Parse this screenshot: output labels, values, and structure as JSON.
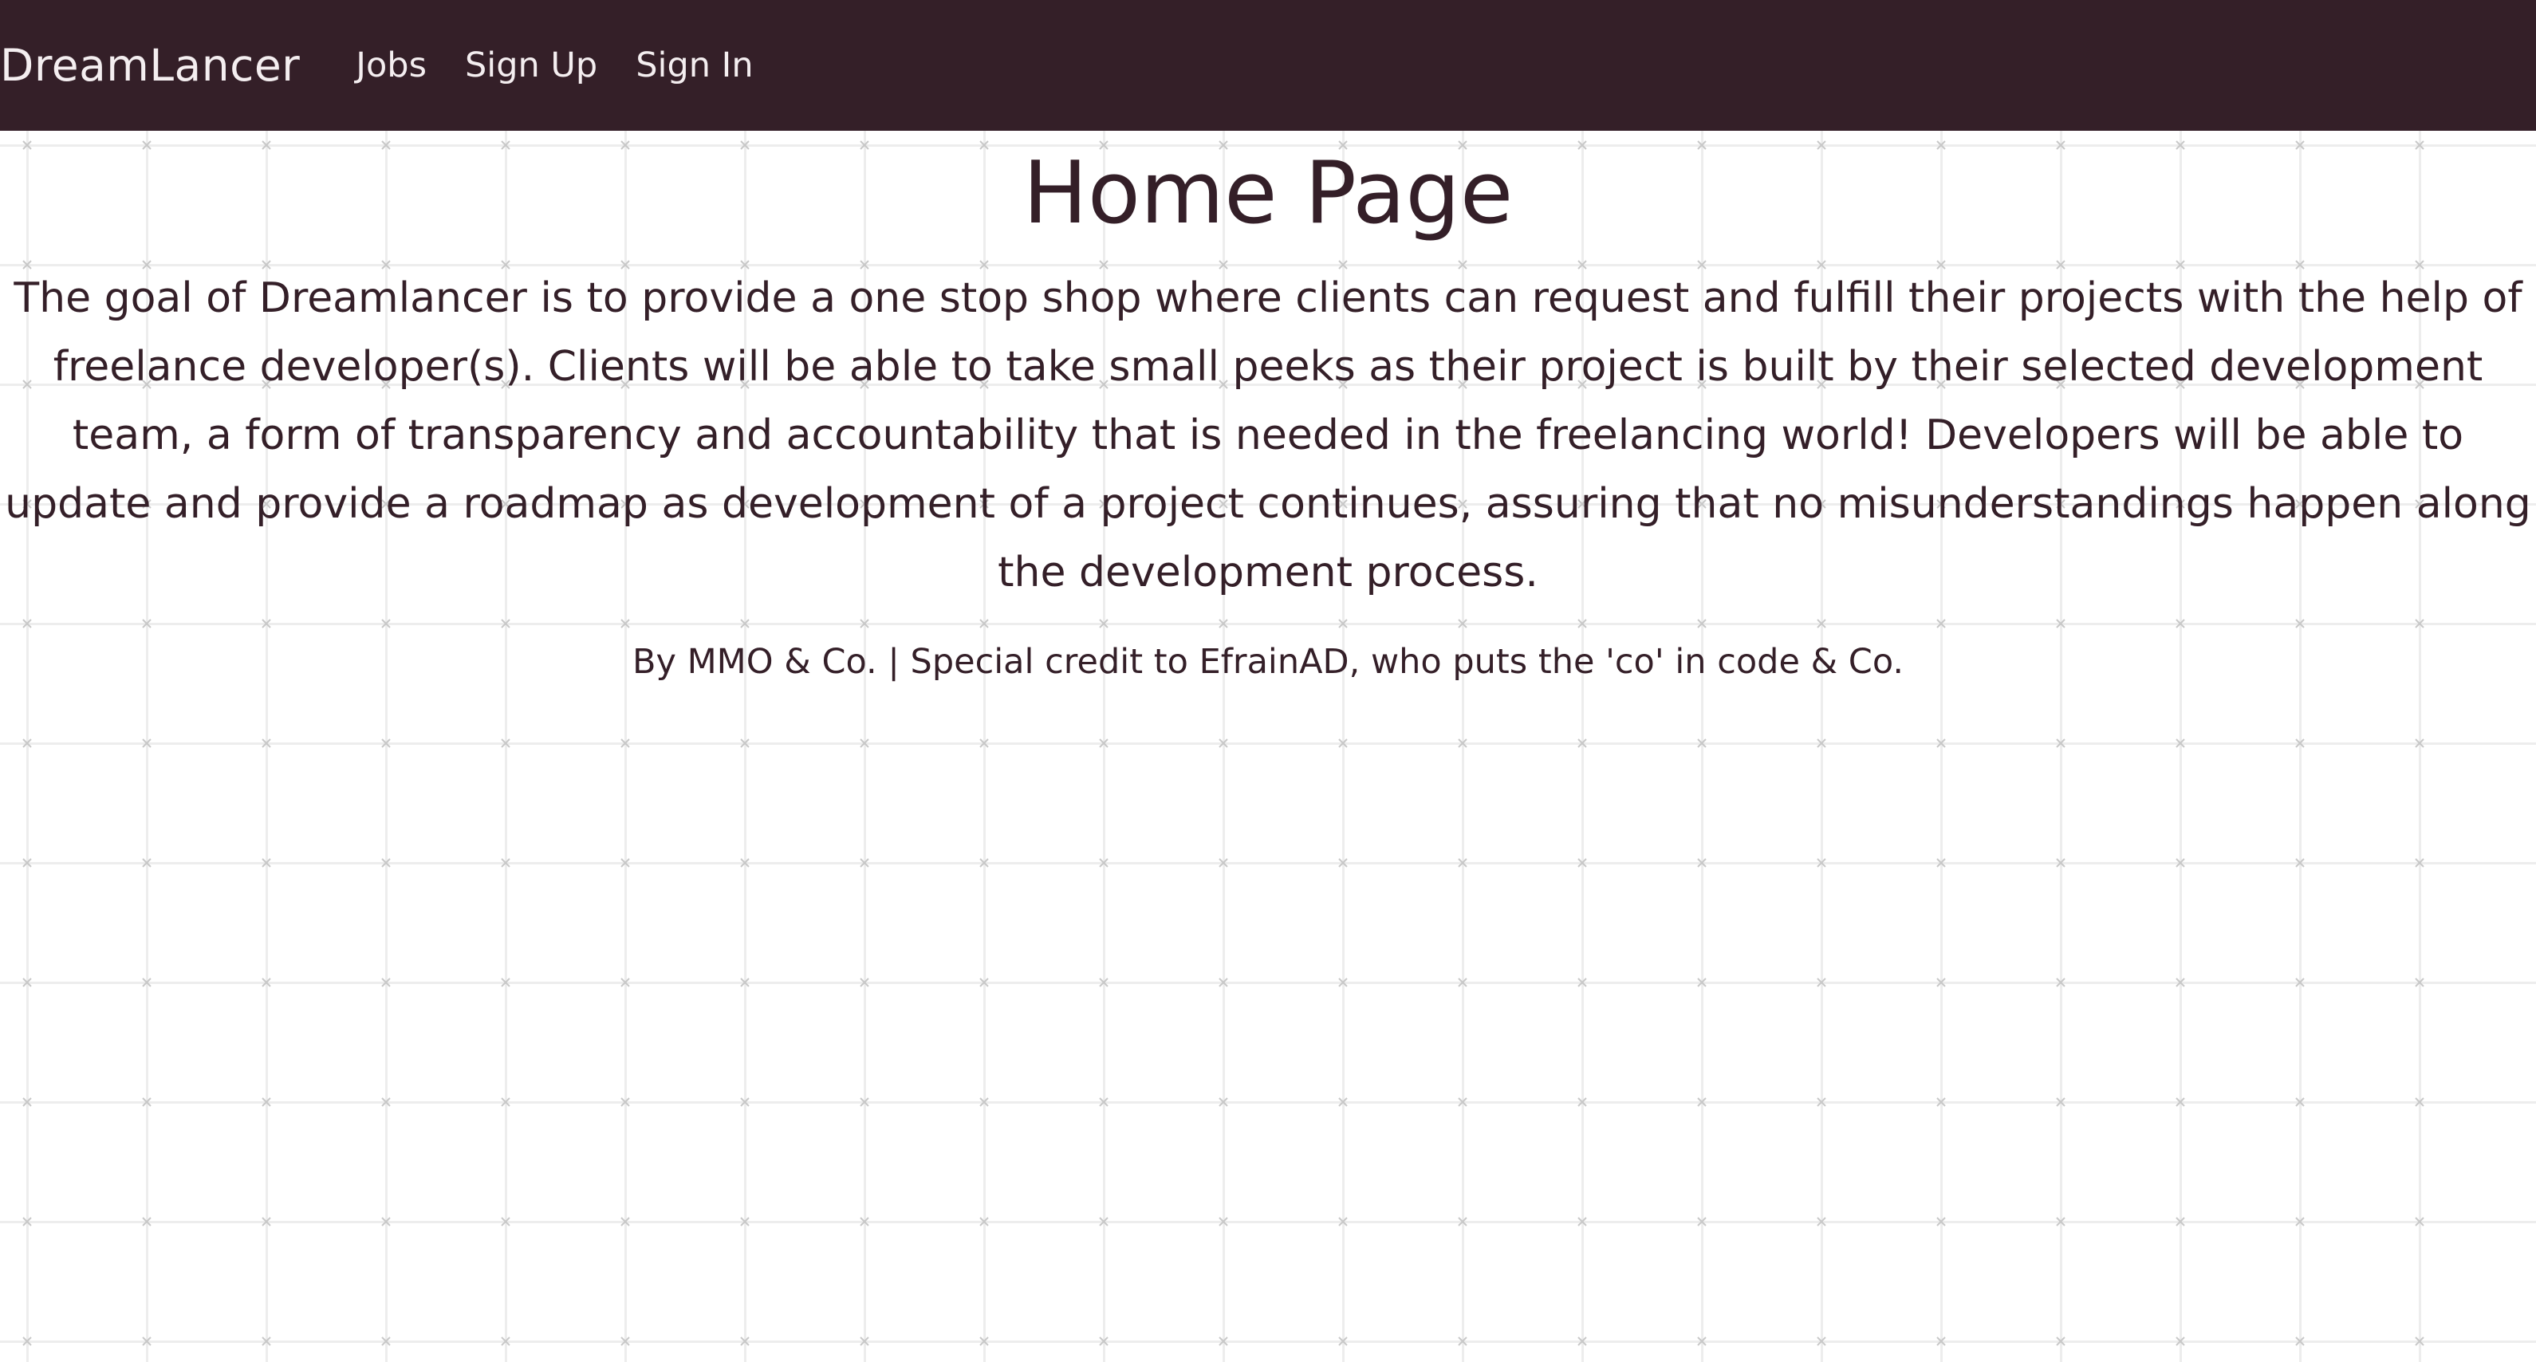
{
  "navbar": {
    "brand": "DreamLancer",
    "links": [
      {
        "label": "Jobs"
      },
      {
        "label": "Sign Up"
      },
      {
        "label": "Sign In"
      }
    ]
  },
  "main": {
    "title": "Home Page",
    "description": "The goal of Dreamlancer is to provide a one stop shop where clients can request and fulfill their projects with the help of freelance developer(s). Clients will be able to take small peeks as their project is built by their selected development team, a form of transparency and accountability that is needed in the freelancing world! Developers will be able to update and provide a roadmap as development of a project continues, assuring that no misunderstandings happen along the development process.",
    "credit": "By MMO & Co. | Special credit to EfrainAD, who puts the 'co' in code & Co."
  },
  "colors": {
    "navbar_bg": "#341f28",
    "nav_text": "#f4eef0",
    "body_text": "#341f28",
    "grid": "#e8e8e8"
  }
}
